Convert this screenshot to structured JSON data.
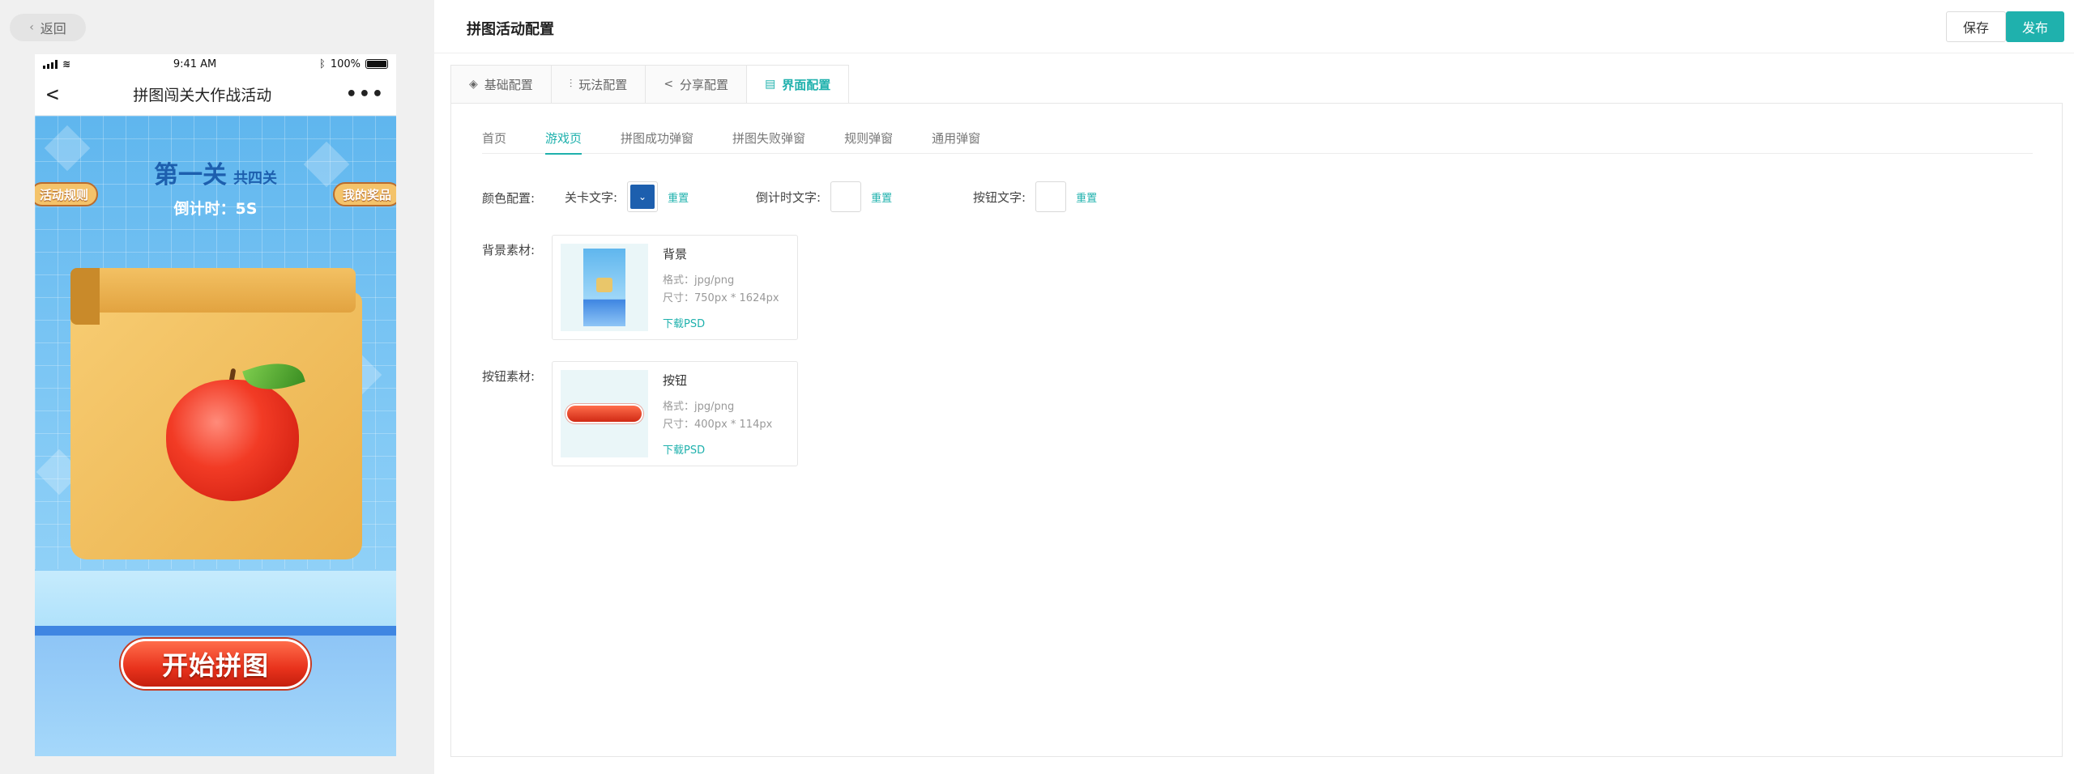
{
  "left": {
    "back_label": "返回",
    "status": {
      "time": "9:41 AM",
      "battery": "100%"
    },
    "nav_title": "拼图闯关大作战活动",
    "nav_more": "•••",
    "game": {
      "level_title": "第一关",
      "level_total": "共四关",
      "countdown": "倒计时：5S",
      "left_pill": "活动规则",
      "right_pill": "我的奖品",
      "start_button": "开始拼图"
    }
  },
  "right": {
    "page_title": "拼图活动配置",
    "save_label": "保存",
    "publish_label": "发布",
    "main_tabs": [
      {
        "label": "基础配置",
        "icon": "layers-icon"
      },
      {
        "label": "玩法配置",
        "icon": "sliders-icon"
      },
      {
        "label": "分享配置",
        "icon": "share-icon"
      },
      {
        "label": "界面配置",
        "icon": "layout-icon",
        "active": true
      }
    ],
    "sub_tabs": [
      "首页",
      "游戏页",
      "拼图成功弹窗",
      "拼图失败弹窗",
      "规则弹窗",
      "通用弹窗"
    ],
    "active_sub_tab": "游戏页",
    "color_config": {
      "label": "颜色配置:",
      "items": [
        {
          "label": "关卡文字:",
          "color": "#1d5fae",
          "reset": "重置"
        },
        {
          "label": "倒计时文字:",
          "color": "#ffffff",
          "reset": "重置"
        },
        {
          "label": "按钮文字:",
          "color": "#ffffff",
          "reset": "重置"
        }
      ]
    },
    "bg_asset": {
      "label": "背景素材:",
      "name": "背景",
      "format": "格式：jpg/png",
      "size": "尺寸：750px * 1624px",
      "download": "下载PSD"
    },
    "btn_asset": {
      "label": "按钮素材:",
      "name": "按钮",
      "format": "格式：jpg/png",
      "size": "尺寸：400px * 114px",
      "download": "下载PSD"
    }
  },
  "colors": {
    "accent": "#1fb1ad",
    "start_button": "#e8321c",
    "level_text": "#1d5fae"
  }
}
